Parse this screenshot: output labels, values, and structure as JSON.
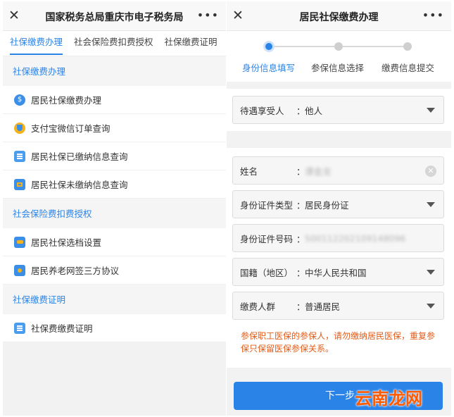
{
  "left": {
    "title": "国家税务总局重庆市电子税务局",
    "tabs": [
      "社保缴费办理",
      "社会保险费扣费授权",
      "社保缴费证明"
    ],
    "sections": [
      {
        "title": "社保缴费办理",
        "items": [
          "居民社保缴费办理",
          "支付宝微信订单查询",
          "居民社保已缴纳信息查询",
          "居民社保未缴纳信息查询"
        ]
      },
      {
        "title": "社会保险费扣费授权",
        "items": [
          "居民社保选档设置",
          "居民养老网签三方协议"
        ]
      },
      {
        "title": "社保缴费证明",
        "items": [
          "社保费缴费证明"
        ]
      }
    ]
  },
  "right": {
    "title": "居民社保缴费办理",
    "steps": [
      "身份信息填写",
      "参保信息选择",
      "缴费信息提交"
    ],
    "beneficiary": {
      "label": "待遇享受人",
      "value": "他人"
    },
    "name": {
      "label": "姓名",
      "value": "谭金龙"
    },
    "id_type": {
      "label": "身份证件类型",
      "value": "居民身份证"
    },
    "id_number": {
      "label": "身份证件号码",
      "value": "500112202109148096"
    },
    "nationality": {
      "label": "国籍（地区）",
      "value": "中华人民共和国"
    },
    "payer_group": {
      "label": "缴费人群",
      "value": "普通居民"
    },
    "colon": "：",
    "warning": "参保职工医保的参保人，请勿缴纳居民医保，重复参保只保留医保参保关系。",
    "next_button": "下一步"
  },
  "watermark": "云南龙网",
  "icons": {
    "close": "close-icon",
    "more": "more-icon",
    "caret": "caret-down-icon",
    "clear": "clear-icon"
  },
  "colors": {
    "accent": "#2a84e8",
    "warning": "#e25b17"
  }
}
